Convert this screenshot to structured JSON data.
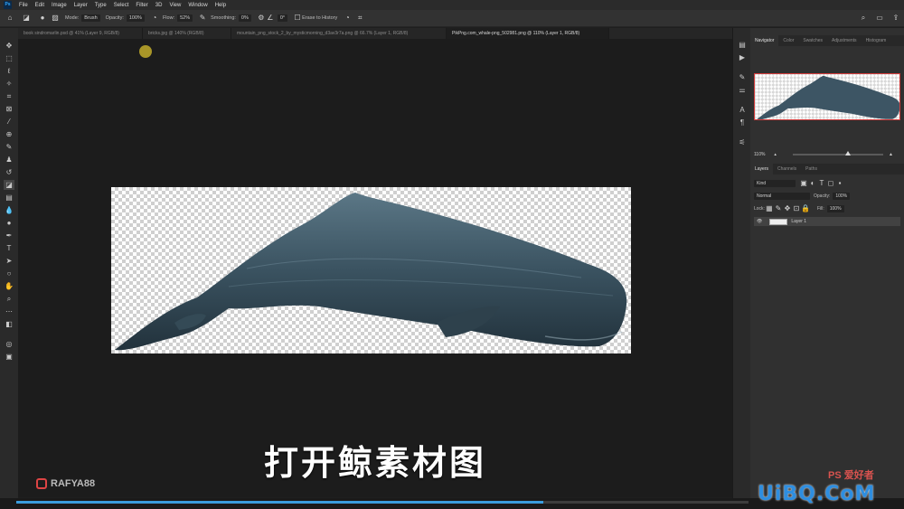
{
  "menubar": {
    "app_icon": "Ps",
    "items": [
      "File",
      "Edit",
      "Image",
      "Layer",
      "Type",
      "Select",
      "Filter",
      "3D",
      "View",
      "Window",
      "Help"
    ]
  },
  "options": {
    "mode_label": "Mode:",
    "mode_value": "Brush",
    "opacity_label": "Opacity:",
    "opacity_value": "100%",
    "flow_label": "Flow:",
    "flow_value": "52%",
    "smoothing_label": "Smoothing:",
    "smoothing_value": "0%",
    "angle_value": "0°",
    "erase_history_label": "Erase to History"
  },
  "tabs": [
    {
      "label": "book sindromarlin.psd @ 41% (Layer 9, RGB/8)",
      "active": false
    },
    {
      "label": "bricks.jpg @ 140% (RGB/8)",
      "active": false
    },
    {
      "label": "mountain_png_stock_2_by_mysticmorning_d3av3r7a.png @ 66.7% (Layer 1, RGB/8)",
      "active": false
    },
    {
      "label": "PikPng.com_whale-png_502981.png @ 110% (Layer 1, RGB/8)",
      "active": true
    }
  ],
  "subtitle": "打开鲸素材图",
  "watermark": "RAFYA88",
  "panels": {
    "top_tabs": [
      "Navigator",
      "Color",
      "Swatches",
      "Adjustments",
      "Histogram"
    ],
    "zoom_value": "110%",
    "layer_tabs": [
      "Layers",
      "Channels",
      "Paths"
    ],
    "kind_label": "Kind",
    "blend_mode": "Normal",
    "opacity_label": "Opacity:",
    "opacity_value": "100%",
    "lock_label": "Lock:",
    "fill_label": "Fill:",
    "fill_value": "100%",
    "layer_name": "Layer 1"
  },
  "video": {
    "progress": 0.72
  },
  "brand": {
    "main": "UiBQ.CoM",
    "sub": "PS 爱好者"
  },
  "colors": {
    "accent": "#3a9dde",
    "brand": "#2e8ee0",
    "nav_frame": "#d23b3b"
  }
}
